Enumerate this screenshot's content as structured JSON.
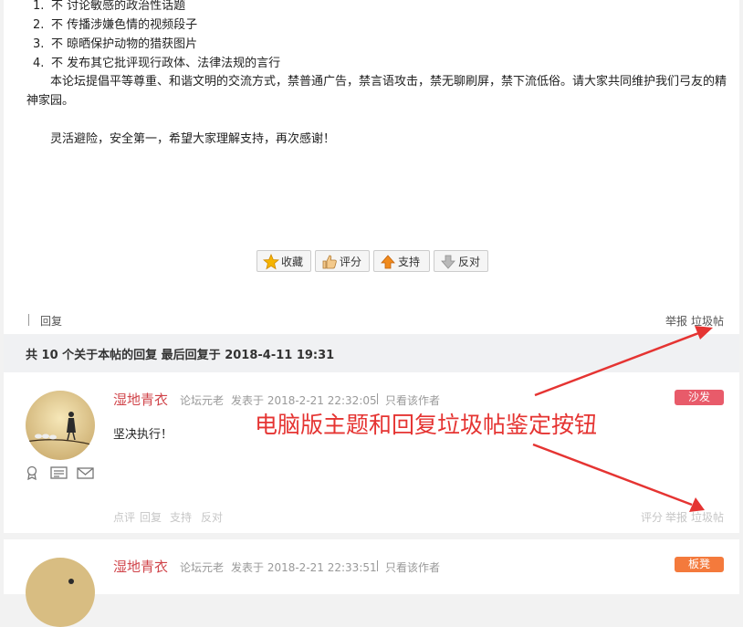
{
  "post": {
    "rules": [
      {
        "num": "1.",
        "text": "不 讨论敏感的政治性话题"
      },
      {
        "num": "2.",
        "text": "不 传播涉嫌色情的视频段子"
      },
      {
        "num": "3.",
        "text": "不 晾晒保护动物的猎获图片"
      },
      {
        "num": "4.",
        "text": "不 发布其它批评现行政体、法律法规的言行"
      }
    ],
    "paragraph1": "本论坛提倡平等尊重、和谐文明的交流方式，禁普通广告，禁言语攻击，禁无聊刷屏，禁下流低俗。请大家共同维护我们弓友的精神家园。",
    "paragraph2": "灵活避险，安全第一，希望大家理解支持，再次感谢！",
    "buttons": {
      "favorite": "收藏",
      "rate": "评分",
      "support": "支持",
      "oppose": "反对"
    },
    "footer": {
      "reply": "回复",
      "report": "举报",
      "spam": "垃圾帖"
    }
  },
  "summary": "共 10 个关于本帖的回复 最后回复于 2018-4-11 19:31",
  "replies": [
    {
      "author": "湿地青衣",
      "rank": "论坛元老",
      "posted": "发表于 2018-2-21 22:32:05",
      "view_author": "只看该作者",
      "floor": "沙发",
      "floor_color": "#e85b6a",
      "content": "坚决执行！",
      "actions": {
        "comment": "点评",
        "reply": "回复",
        "support": "支持",
        "oppose": "反对",
        "rate": "评分",
        "report": "举报",
        "spam": "垃圾帖"
      }
    },
    {
      "author": "湿地青衣",
      "rank": "论坛元老",
      "posted": "发表于 2018-2-21 22:33:51",
      "view_author": "只看该作者",
      "floor": "板凳",
      "floor_color": "#f47a3c"
    }
  ],
  "annotation": "电脑版主题和回复垃圾帖鉴定按钮",
  "colors": {
    "accent_red": "#e53432",
    "author": "#d0444a",
    "summary_bg": "#f0f1f3"
  }
}
